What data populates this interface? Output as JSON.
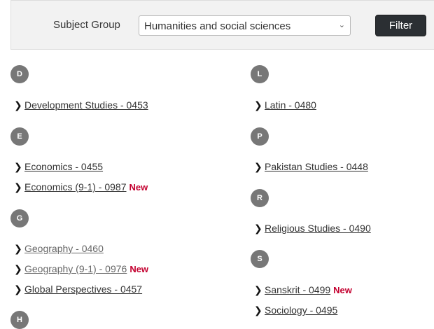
{
  "filter": {
    "label": "Subject Group",
    "selected": "Humanities and social sciences",
    "button_label": "Filter"
  },
  "new_label": "New",
  "groups": {
    "d": {
      "letter": "D",
      "items": [
        {
          "label": "Development Studies - 0453"
        }
      ]
    },
    "e": {
      "letter": "E",
      "items": [
        {
          "label": "Economics - 0455"
        },
        {
          "label": "Economics (9-1) - 0987",
          "is_new": true
        }
      ]
    },
    "g": {
      "letter": "G",
      "items": [
        {
          "label": "Geography - 0460"
        },
        {
          "label": "Geography (9-1) - 0976",
          "is_new": true
        },
        {
          "label": "Global Perspectives - 0457"
        }
      ]
    },
    "h": {
      "letter": "H",
      "items": []
    },
    "l": {
      "letter": "L",
      "items": [
        {
          "label": "Latin - 0480"
        }
      ]
    },
    "p": {
      "letter": "P",
      "items": [
        {
          "label": "Pakistan Studies - 0448"
        }
      ]
    },
    "r": {
      "letter": "R",
      "items": [
        {
          "label": "Religious Studies - 0490"
        }
      ]
    },
    "s": {
      "letter": "S",
      "items": [
        {
          "label": "Sanskrit - 0499",
          "is_new": true
        },
        {
          "label": "Sociology - 0495"
        }
      ]
    }
  }
}
